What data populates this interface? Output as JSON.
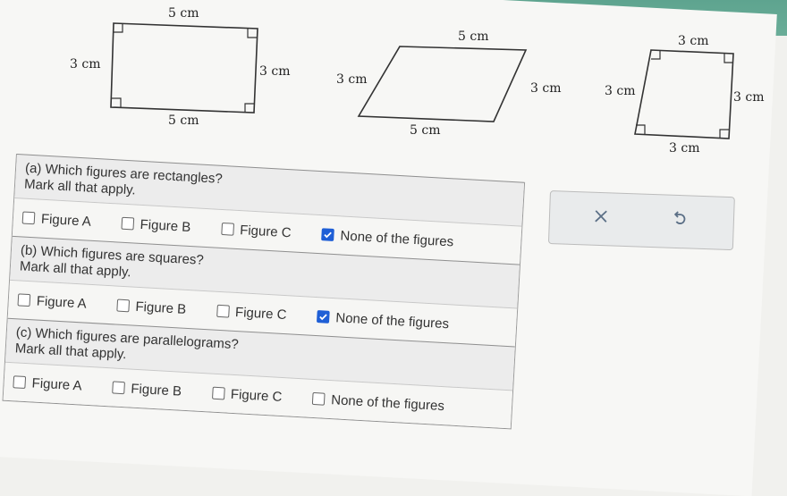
{
  "figures": [
    {
      "id": "A",
      "top": "5 cm",
      "left": "3 cm",
      "right": "3 cm",
      "bottom": "5 cm"
    },
    {
      "id": "B",
      "top": "5 cm",
      "left": "3 cm",
      "right": "3 cm",
      "bottom": "5 cm"
    },
    {
      "id": "C",
      "top": "3 cm",
      "left": "3 cm",
      "right": "3 cm",
      "bottom": "3 cm"
    }
  ],
  "questions": [
    {
      "title": "(a) Which figures are rectangles?",
      "instruction": "Mark all that apply.",
      "options": [
        {
          "label": "Figure A",
          "checked": false
        },
        {
          "label": "Figure B",
          "checked": false
        },
        {
          "label": "Figure C",
          "checked": false
        },
        {
          "label": "None of the figures",
          "checked": true
        }
      ]
    },
    {
      "title": "(b) Which figures are squares?",
      "instruction": "Mark all that apply.",
      "options": [
        {
          "label": "Figure A",
          "checked": false
        },
        {
          "label": "Figure B",
          "checked": false
        },
        {
          "label": "Figure C",
          "checked": false
        },
        {
          "label": "None of the figures",
          "checked": true
        }
      ]
    },
    {
      "title": "(c) Which figures are parallelograms?",
      "instruction": "Mark all that apply.",
      "options": [
        {
          "label": "Figure A",
          "checked": false
        },
        {
          "label": "Figure B",
          "checked": false
        },
        {
          "label": "Figure C",
          "checked": false
        },
        {
          "label": "None of the figures",
          "checked": false
        }
      ]
    }
  ],
  "actions": {
    "clear_icon": "x-icon",
    "undo_icon": "undo-icon"
  },
  "colors": {
    "check": "#1f5fd6",
    "header_bar": "#5ea48f"
  }
}
